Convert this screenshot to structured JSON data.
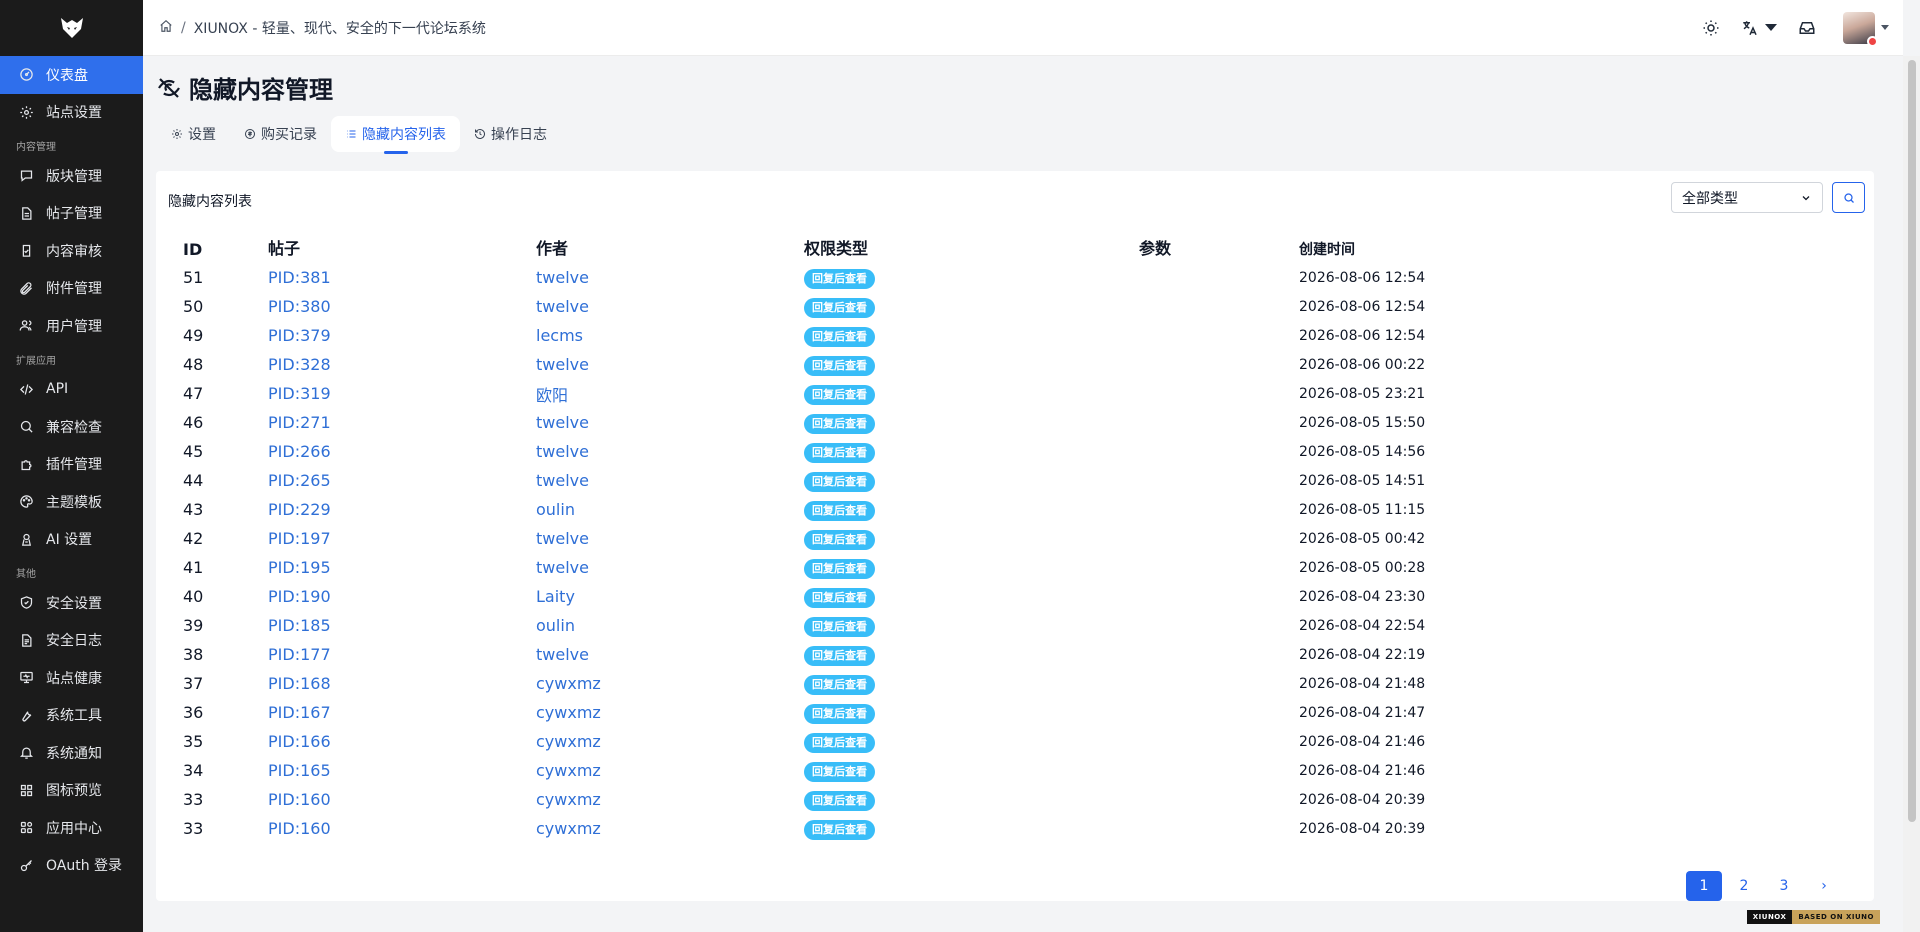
{
  "sidebar": {
    "items_top": [
      {
        "label": "仪表盘",
        "icon": "dashboard-icon",
        "active": true
      },
      {
        "label": "站点设置",
        "icon": "gear-icon"
      }
    ],
    "section_content": "内容管理",
    "items_content": [
      {
        "label": "版块管理",
        "icon": "chat-bubble-icon"
      },
      {
        "label": "帖子管理",
        "icon": "document-icon"
      },
      {
        "label": "内容审核",
        "icon": "clipboard-check-icon"
      },
      {
        "label": "附件管理",
        "icon": "paperclip-icon"
      },
      {
        "label": "用户管理",
        "icon": "users-icon"
      }
    ],
    "section_ext": "扩展应用",
    "items_ext": [
      {
        "label": "API",
        "icon": "code-icon"
      },
      {
        "label": "兼容检查",
        "icon": "search-icon"
      },
      {
        "label": "插件管理",
        "icon": "puzzle-icon"
      },
      {
        "label": "主题模板",
        "icon": "palette-icon"
      },
      {
        "label": "AI 设置",
        "icon": "ai-icon"
      }
    ],
    "section_other": "其他",
    "items_other": [
      {
        "label": "安全设置",
        "icon": "shield-icon"
      },
      {
        "label": "安全日志",
        "icon": "log-icon"
      },
      {
        "label": "站点健康",
        "icon": "monitor-icon"
      },
      {
        "label": "系统工具",
        "icon": "wrench-icon"
      },
      {
        "label": "系统通知",
        "icon": "bell-icon"
      },
      {
        "label": "图标预览",
        "icon": "grid-icon"
      },
      {
        "label": "应用中心",
        "icon": "apps-icon"
      },
      {
        "label": "OAuth 登录",
        "icon": "key-icon"
      }
    ]
  },
  "topbar": {
    "breadcrumb_sep": "/",
    "breadcrumb_title": "XIUNOX - 轻量、现代、安全的下一代论坛系统"
  },
  "page": {
    "title": "隐藏内容管理",
    "tabs": [
      {
        "label": "设置",
        "icon": "gear-icon"
      },
      {
        "label": "购买记录",
        "icon": "coin-icon"
      },
      {
        "label": "隐藏内容列表",
        "icon": "list-icon",
        "active": true
      },
      {
        "label": "操作日志",
        "icon": "history-icon"
      }
    ],
    "card_title": "隐藏内容列表",
    "type_select": "全部类型",
    "columns": [
      "ID",
      "帖子",
      "作者",
      "权限类型",
      "参数",
      "创建时间"
    ],
    "rows": [
      {
        "id": "51",
        "post": "PID:381",
        "author": "twelve",
        "type": "回复后查看",
        "param": "",
        "time": "2026-08-06 12:54"
      },
      {
        "id": "50",
        "post": "PID:380",
        "author": "twelve",
        "type": "回复后查看",
        "param": "",
        "time": "2026-08-06 12:54"
      },
      {
        "id": "49",
        "post": "PID:379",
        "author": "lecms",
        "type": "回复后查看",
        "param": "",
        "time": "2026-08-06 12:54"
      },
      {
        "id": "48",
        "post": "PID:328",
        "author": "twelve",
        "type": "回复后查看",
        "param": "",
        "time": "2026-08-06 00:22"
      },
      {
        "id": "47",
        "post": "PID:319",
        "author": "欧阳",
        "type": "回复后查看",
        "param": "",
        "time": "2026-08-05 23:21"
      },
      {
        "id": "46",
        "post": "PID:271",
        "author": "twelve",
        "type": "回复后查看",
        "param": "",
        "time": "2026-08-05 15:50"
      },
      {
        "id": "45",
        "post": "PID:266",
        "author": "twelve",
        "type": "回复后查看",
        "param": "",
        "time": "2026-08-05 14:56"
      },
      {
        "id": "44",
        "post": "PID:265",
        "author": "twelve",
        "type": "回复后查看",
        "param": "",
        "time": "2026-08-05 14:51"
      },
      {
        "id": "43",
        "post": "PID:229",
        "author": "oulin",
        "type": "回复后查看",
        "param": "",
        "time": "2026-08-05 11:15"
      },
      {
        "id": "42",
        "post": "PID:197",
        "author": "twelve",
        "type": "回复后查看",
        "param": "",
        "time": "2026-08-05 00:42"
      },
      {
        "id": "41",
        "post": "PID:195",
        "author": "twelve",
        "type": "回复后查看",
        "param": "",
        "time": "2026-08-05 00:28"
      },
      {
        "id": "40",
        "post": "PID:190",
        "author": "Laity",
        "type": "回复后查看",
        "param": "",
        "time": "2026-08-04 23:30"
      },
      {
        "id": "39",
        "post": "PID:185",
        "author": "oulin",
        "type": "回复后查看",
        "param": "",
        "time": "2026-08-04 22:54"
      },
      {
        "id": "38",
        "post": "PID:177",
        "author": "twelve",
        "type": "回复后查看",
        "param": "",
        "time": "2026-08-04 22:19"
      },
      {
        "id": "37",
        "post": "PID:168",
        "author": "cywxmz",
        "type": "回复后查看",
        "param": "",
        "time": "2026-08-04 21:48"
      },
      {
        "id": "36",
        "post": "PID:167",
        "author": "cywxmz",
        "type": "回复后查看",
        "param": "",
        "time": "2026-08-04 21:47"
      },
      {
        "id": "35",
        "post": "PID:166",
        "author": "cywxmz",
        "type": "回复后查看",
        "param": "",
        "time": "2026-08-04 21:46"
      },
      {
        "id": "34",
        "post": "PID:165",
        "author": "cywxmz",
        "type": "回复后查看",
        "param": "",
        "time": "2026-08-04 21:46"
      },
      {
        "id": "33",
        "post": "PID:160",
        "author": "cywxmz",
        "type": "回复后查看",
        "param": "",
        "time": "2026-08-04 20:39"
      },
      {
        "id": "33",
        "post": "PID:160",
        "author": "cywxmz",
        "type": "回复后查看",
        "param": "",
        "time": "2026-08-04 20:39"
      }
    ],
    "pagination": [
      "1",
      "2",
      "3",
      "›"
    ]
  },
  "footer_badge": {
    "left": "XIUNOX",
    "right": "BASED ON XIUNO"
  },
  "colors": {
    "accent": "#2563eb",
    "sidebar_bg": "#1b1b1b",
    "badge": "#38bdf8",
    "link": "#2f6fd6"
  }
}
